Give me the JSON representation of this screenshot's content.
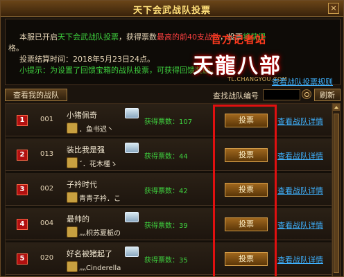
{
  "window": {
    "title": "天下会武战队投票",
    "close": "×"
  },
  "info": {
    "line1_a": "本服已开启",
    "line1_b": "天下会武战队投票",
    "line1_c": "，获得票数",
    "line1_d": "最高的前40支战队",
    "line1_e": "，投票",
    "line1_f": "将获得",
    "line1b": "格。",
    "line2": "投票结算时间：2018年5月23日24点。",
    "line3": "小提示：为设置了回馈宝箱的战队投票，可获得回馈奖励。",
    "rules_link": "查看战队投票规则"
  },
  "logo": {
    "stamp": "官方记者站",
    "big": "天龍八部",
    "url": "TL.CHANGYOU.COM"
  },
  "toolbar": {
    "my_team": "查看我的战队",
    "find_label": "查找战队编号",
    "refresh": "刷新"
  },
  "rows": [
    {
      "rank": "1",
      "num": "001",
      "name": "小猪佩奇",
      "leader": "．鱼书迟丶",
      "votes": "获得票数：107",
      "vote": "投票",
      "detail": "查看战队详情"
    },
    {
      "rank": "2",
      "num": "013",
      "name": "装比我是强",
      "leader": "ˇ．花木槿ゝ",
      "votes": "获得票数：44",
      "vote": "投票",
      "detail": "查看战队详情"
    },
    {
      "rank": "3",
      "num": "002",
      "name": "子衿时代",
      "leader": "青青子衿．こ",
      "votes": "获得票数：42",
      "vote": "投票",
      "detail": "查看战队详情"
    },
    {
      "rank": "4",
      "num": "004",
      "name": "最帅的",
      "leader": "灬枳苏夏栀の",
      "votes": "获得票数：39",
      "vote": "投票",
      "detail": "查看战队详情"
    },
    {
      "rank": "5",
      "num": "020",
      "name": "好名被猪起了",
      "leader": "灬Cinderella",
      "votes": "获得票数：35",
      "vote": "投票",
      "detail": "查看战队详情"
    }
  ],
  "colors": {
    "accent_green": "#3fd23f",
    "link_blue": "#3fb2ff",
    "highlight_red": "#e01010"
  }
}
